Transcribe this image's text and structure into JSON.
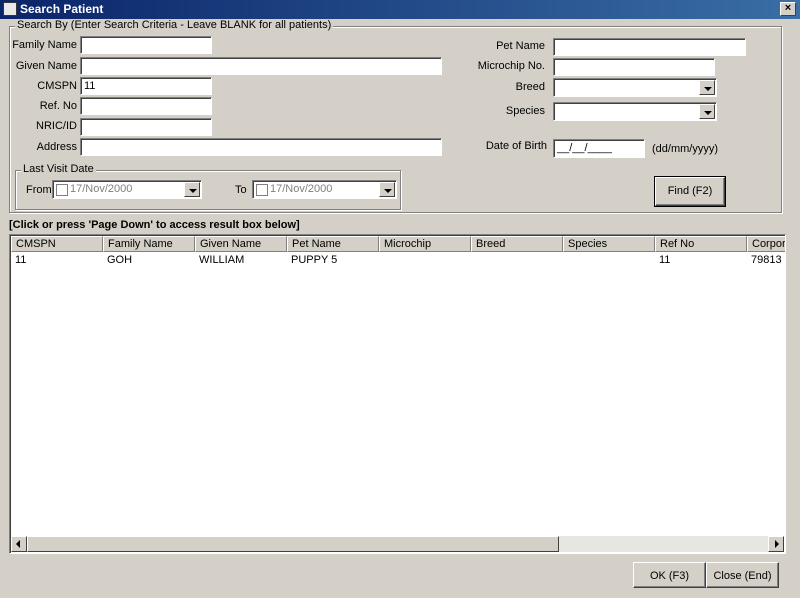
{
  "window": {
    "title": "Search Patient"
  },
  "search": {
    "legend": "Search By (Enter Search Criteria - Leave BLANK for all patients)",
    "family_name_label": "Family Name",
    "family_name_value": "",
    "given_name_label": "Given Name",
    "given_name_value": "",
    "cmspn_label": "CMSPN",
    "cmspn_value": "11",
    "ref_no_label": "Ref. No",
    "ref_no_value": "",
    "nric_label": "NRIC/ID",
    "nric_value": "",
    "address_label": "Address",
    "address_value": "",
    "pet_name_label": "Pet Name",
    "pet_name_value": "",
    "microchip_label": "Microchip No.",
    "microchip_value": "",
    "breed_label": "Breed",
    "breed_value": "",
    "species_label": "Species",
    "species_value": "",
    "dob_label": "Date of Birth",
    "dob_value": "__/__/____",
    "dob_hint": "(dd/mm/yyyy)",
    "last_visit": {
      "legend": "Last Visit Date",
      "from_label": "From",
      "from_value": "17/Nov/2000",
      "to_label": "To",
      "to_value": "17/Nov/2000"
    },
    "find_button": "Find (F2)"
  },
  "results": {
    "note": "[Click or press 'Page Down' to access result box below]",
    "columns": [
      "CMSPN",
      "Family Name",
      "Given Name",
      "Pet Name",
      "Microchip",
      "Breed",
      "Species",
      "Ref No",
      "Corpora"
    ],
    "rows": [
      [
        "11",
        "GOH",
        "WILLIAM",
        "PUPPY 5",
        "",
        "",
        "",
        "11",
        "79813"
      ]
    ]
  },
  "footer": {
    "ok_button": "OK (F3)",
    "close_button": "Close (End)"
  }
}
